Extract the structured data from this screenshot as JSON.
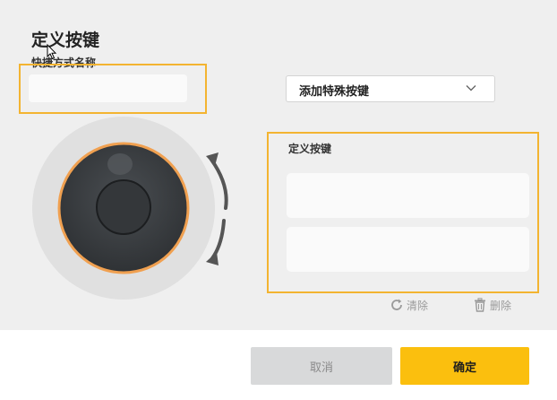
{
  "dialog": {
    "title": "定义按键"
  },
  "shortcut_name": {
    "label": "快捷方式名称",
    "value": "",
    "placeholder": ""
  },
  "special_key_select": {
    "selected": "添加特殊按键"
  },
  "key_panel": {
    "label": "定义按键",
    "slots": [
      "",
      ""
    ]
  },
  "actions": {
    "clear_label": "清除",
    "delete_label": "删除"
  },
  "footer": {
    "cancel_label": "取消",
    "confirm_label": "确定"
  },
  "dial": {
    "rotation_icon": "rotate-arrows-icon"
  },
  "colors": {
    "highlight": "#f3b431",
    "confirm": "#fbbf0e",
    "dial_ring": "#f0a050",
    "dial_body": "#3a3d40"
  }
}
